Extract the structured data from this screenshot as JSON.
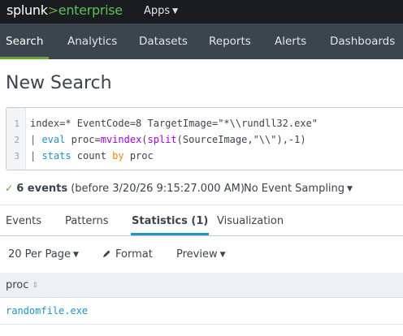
{
  "header": {
    "logo": {
      "brand": "splunk",
      "separator": ">",
      "product": "enterprise"
    },
    "apps_label": "Apps",
    "caret_icon": "caret-down-icon"
  },
  "nav": {
    "items": [
      {
        "label": "Search",
        "active": true
      },
      {
        "label": "Analytics"
      },
      {
        "label": "Datasets"
      },
      {
        "label": "Reports"
      },
      {
        "label": "Alerts"
      },
      {
        "label": "Dashboards"
      }
    ]
  },
  "page": {
    "title": "New Search"
  },
  "query": {
    "line_numbers": [
      "1",
      "2",
      "3"
    ],
    "line1": "index=* EventCode=8 TargetImage=\"*\\\\rundll32.exe\"",
    "line2": {
      "pipe": "| ",
      "cmd": "eval",
      "rest1": " proc=",
      "fn1": "mvindex",
      "rest2": "(",
      "fn2": "split",
      "rest3": "(SourceImage,\"\\\\\"),-1)"
    },
    "line3": {
      "pipe": "| ",
      "cmd": "stats",
      "rest1": " count ",
      "by": "by",
      "rest2": " proc"
    }
  },
  "status": {
    "check_icon": "check-icon",
    "check": "✓",
    "events": "6 events",
    "before": "(before 3/20/26 9:15:27.000 AM)",
    "sampling": "No Event Sampling"
  },
  "tabs": [
    {
      "label": "Events"
    },
    {
      "label": "Patterns"
    },
    {
      "label": "Statistics (1)",
      "active": true
    },
    {
      "label": "Visualization"
    }
  ],
  "toolbar": {
    "per_page": "20 Per Page",
    "format": "Format",
    "preview": "Preview"
  },
  "table": {
    "columns": [
      {
        "label": "proc"
      }
    ],
    "rows": [
      [
        "randomfile.exe"
      ]
    ]
  },
  "colors": {
    "accent_green": "#65a637",
    "link_blue": "#1e93c6",
    "nav_bg": "#3c444d",
    "top_bg": "#1a1c20"
  }
}
